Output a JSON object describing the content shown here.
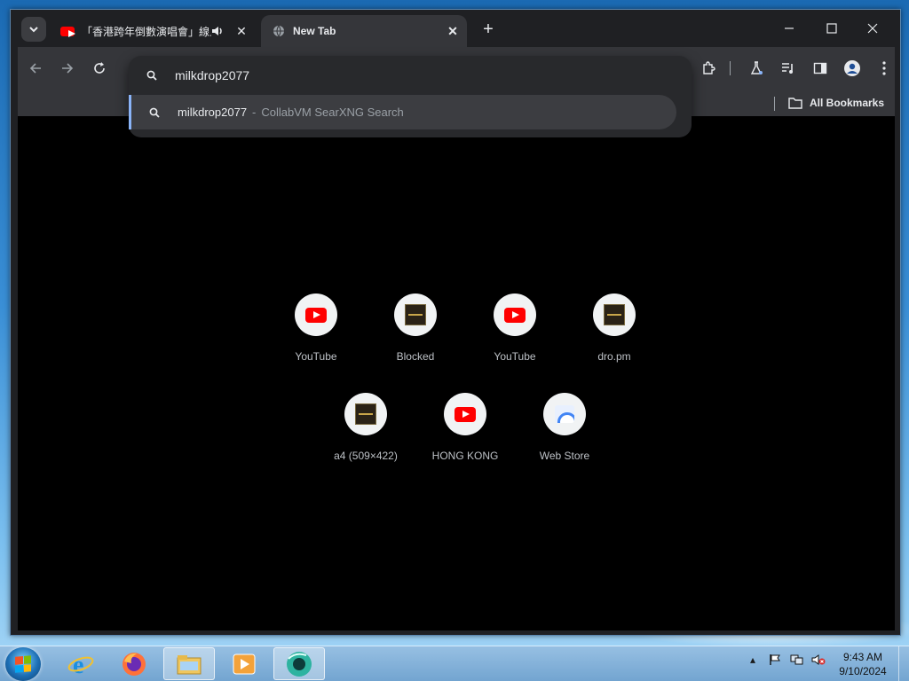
{
  "browser": {
    "tabs": [
      {
        "title": "「香港跨年倒數演唱會」線上",
        "favicon": "youtube-icon",
        "audio": true
      },
      {
        "title": "New Tab",
        "favicon": "globe-icon",
        "active": true
      }
    ],
    "bookmarks_label": "All Bookmarks"
  },
  "omnibox": {
    "input_value": "milkdrop2077",
    "suggestion_main": "milkdrop2077",
    "suggestion_sep": "-",
    "suggestion_sub": "CollabVM SearXNG Search"
  },
  "shortcuts": [
    {
      "label": "YouTube",
      "icon": "youtube-icon"
    },
    {
      "label": "Blocked",
      "icon": "thumbnail-icon"
    },
    {
      "label": "YouTube",
      "icon": "youtube-icon"
    },
    {
      "label": "dro.pm",
      "icon": "thumbnail-icon"
    },
    {
      "label": "a4 (509×422)",
      "icon": "thumbnail-icon"
    },
    {
      "label": "HONG KONG",
      "icon": "youtube-icon"
    },
    {
      "label": "Web Store",
      "icon": "webstore-icon"
    }
  ],
  "taskbar": {
    "time": "9:43 AM",
    "date": "9/10/2024"
  }
}
